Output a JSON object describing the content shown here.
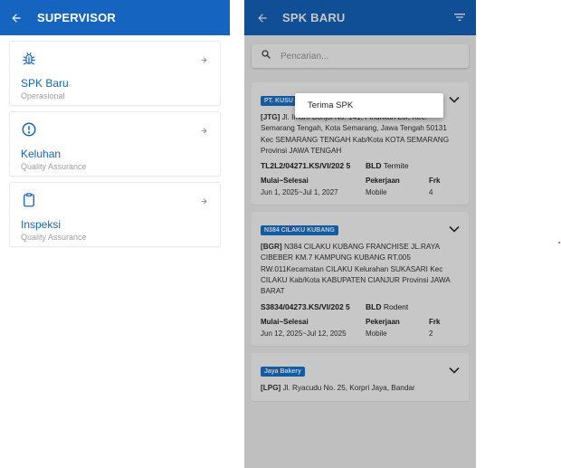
{
  "left": {
    "appbar": {
      "title": "SUPERVISOR"
    },
    "items": [
      {
        "label": "SPK Baru",
        "sub": "Operasional",
        "icon": "bug-icon"
      },
      {
        "label": "Keluhan",
        "sub": "Quality Assurance",
        "icon": "alert-circle-icon"
      },
      {
        "label": "Inspeksi",
        "sub": "Quality Assurance",
        "icon": "clipboard-icon"
      }
    ]
  },
  "right": {
    "appbar": {
      "title": "SPK BARU"
    },
    "search": {
      "placeholder": "Pencarian..."
    },
    "popup": {
      "label": "Terima SPK"
    },
    "headers": {
      "period": "Mulai~Selesai",
      "job": "Pekerjaan",
      "freq": "Frk"
    },
    "cards": [
      {
        "badge": "PT. KUSU",
        "code": "[JTG]",
        "address": "Jl. Imam Bonjol No. 141, Pindrikan Lor, Kec. Semarang Tengah, Kota Semarang, Jawa Tengah 50131 Kec SEMARANG TENGAH Kab/Kota KOTA SEMARANG Provinsi JAWA TENGAH",
        "number": "TL2L2/04271.KS/VI/202 5",
        "bld_label": "BLD",
        "bld_value": "Termite",
        "period": "Jun 1, 2025~Jul 1, 2027",
        "job": "Mobile",
        "freq": "4"
      },
      {
        "badge": "N384 CILAKU KUBANG",
        "code": "[BGR]",
        "address": "N384 CILAKU KUBANG FRANCHISE JL.RAYA CIBEBER KM.7 KAMPUNG KUBANG RT.005 RW.011Kecamatan CILAKU Kelurahan SUKASARI Kec CILAKU Kab/Kota KABUPATEN CIANJUR Provinsi JAWA BARAT",
        "number": "S3834/04273.KS/VI/202 5",
        "bld_label": "BLD",
        "bld_value": "Rodent",
        "period": "Jun 12, 2025~Jul 12, 2025",
        "job": "Mobile",
        "freq": "2"
      },
      {
        "badge": "Jaya Bakery",
        "code": "[LPG]",
        "address": "Jl. Ryacudu No. 25, Korpri Jaya, Bandar"
      }
    ]
  }
}
